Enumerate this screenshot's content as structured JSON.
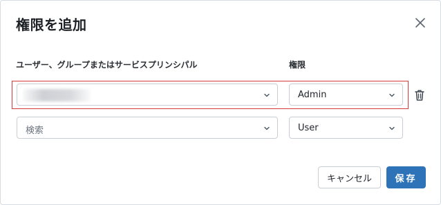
{
  "dialog": {
    "title": "権限を追加",
    "close_icon": "close-icon"
  },
  "columns": {
    "principal_label": "ユーザー、グループまたはサービスプリンシパル",
    "permission_label": "権限"
  },
  "rows": [
    {
      "principal_value": "",
      "principal_redacted": true,
      "permission_value": "Admin",
      "highlighted": true,
      "delete_icon": "trash-icon"
    },
    {
      "principal_placeholder": "検索",
      "permission_value": "User",
      "highlighted": false
    }
  ],
  "buttons": {
    "cancel_label": "キャンセル",
    "save_label": "保存"
  },
  "colors": {
    "accent": "#2e73b8",
    "highlight_border": "#d9383b"
  }
}
